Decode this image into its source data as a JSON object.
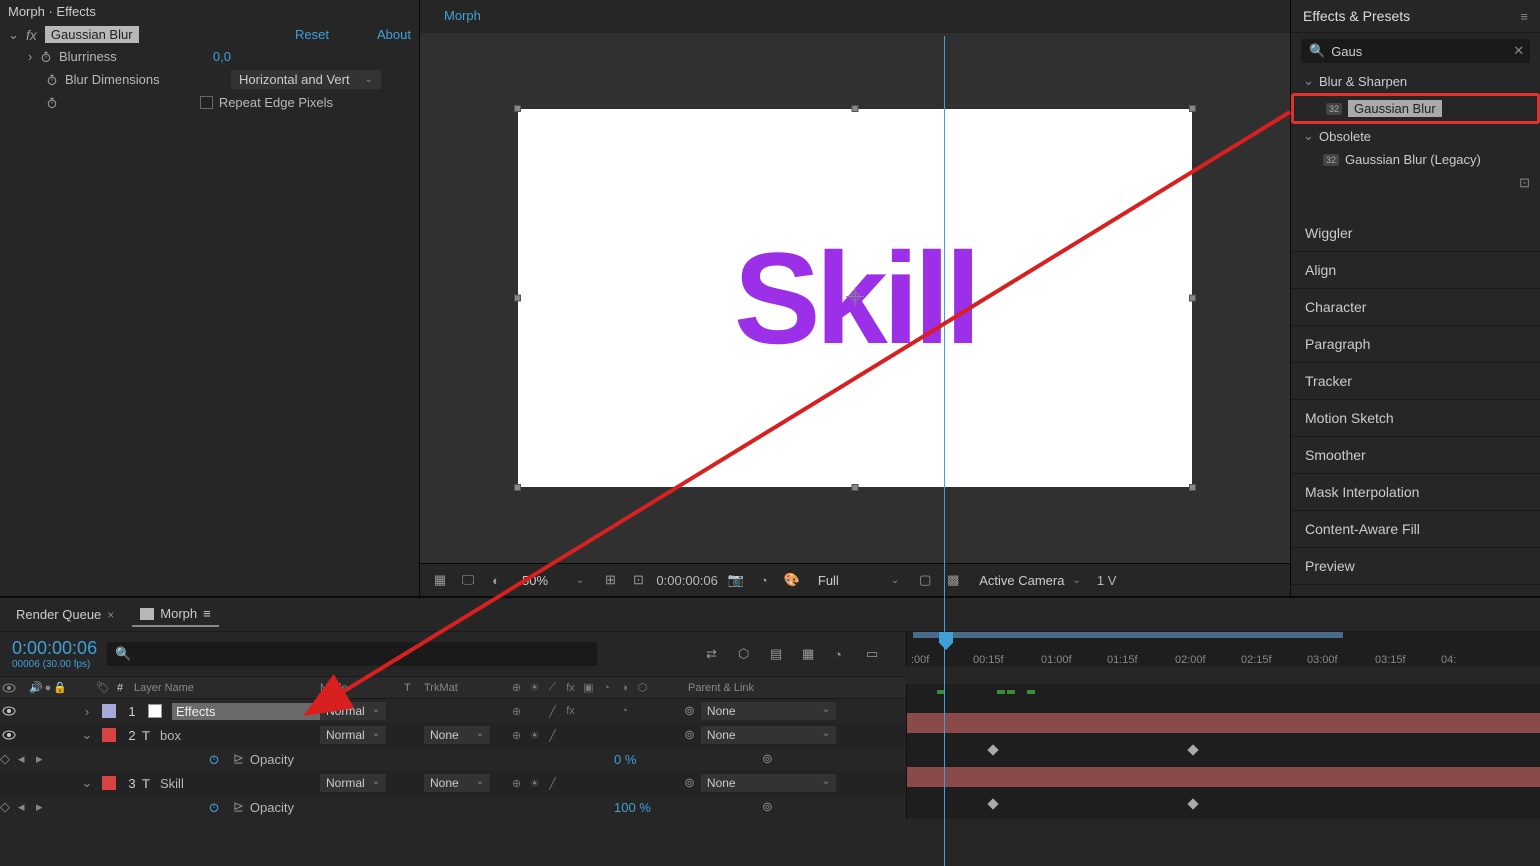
{
  "effect_controls": {
    "title": "Morph · Effects",
    "effect_name": "Gaussian Blur",
    "reset": "Reset",
    "about": "About",
    "props": {
      "blurriness_label": "Blurriness",
      "blurriness_value": "0,0",
      "dimensions_label": "Blur Dimensions",
      "dimensions_value": "Horizontal and Vert",
      "repeat_label": "Repeat Edge Pixels"
    }
  },
  "composition": {
    "tab": "Morph",
    "text": "Skill",
    "viewer": {
      "zoom": "50%",
      "timecode": "0:00:00:06",
      "resolution": "Full",
      "camera": "Active Camera",
      "views": "1 V"
    }
  },
  "effects_presets": {
    "title": "Effects & Presets",
    "search": "Gaus",
    "categories": {
      "blur_sharpen": "Blur & Sharpen",
      "gaussian": "Gaussian Blur",
      "obsolete": "Obsolete",
      "gaussian_legacy": "Gaussian Blur (Legacy)"
    },
    "panels": [
      "Wiggler",
      "Align",
      "Character",
      "Paragraph",
      "Tracker",
      "Motion Sketch",
      "Smoother",
      "Mask Interpolation",
      "Content-Aware Fill",
      "Preview"
    ]
  },
  "timeline": {
    "tabs": {
      "render_queue": "Render Queue",
      "morph": "Morph"
    },
    "timecode": "0:00:00:06",
    "timecode_sub": "00006 (30.00 fps)",
    "headers": {
      "num": "#",
      "layer_name": "Layer Name",
      "mode": "Mode",
      "t": "T",
      "trkmat": "TrkMat",
      "parent": "Parent & Link"
    },
    "ruler": [
      ":00f",
      "00:15f",
      "01:00f",
      "01:15f",
      "02:00f",
      "02:15f",
      "03:00f",
      "03:15f",
      "04:"
    ],
    "layers": [
      {
        "num": "1",
        "name": "Effects",
        "mode": "Normal",
        "trkmat": "",
        "parent": "None",
        "selected": true,
        "swatch": "swatch-purple"
      },
      {
        "num": "2",
        "name": "box",
        "type": "T",
        "mode": "Normal",
        "trkmat": "None",
        "parent": "None",
        "swatch": "swatch-red"
      },
      {
        "num": "3",
        "name": "Skill",
        "type": "T",
        "mode": "Normal",
        "trkmat": "None",
        "parent": "None",
        "swatch": "swatch-red"
      }
    ],
    "opacity_label": "Opacity",
    "opacity_vals": [
      "0 %",
      "100 %"
    ]
  }
}
